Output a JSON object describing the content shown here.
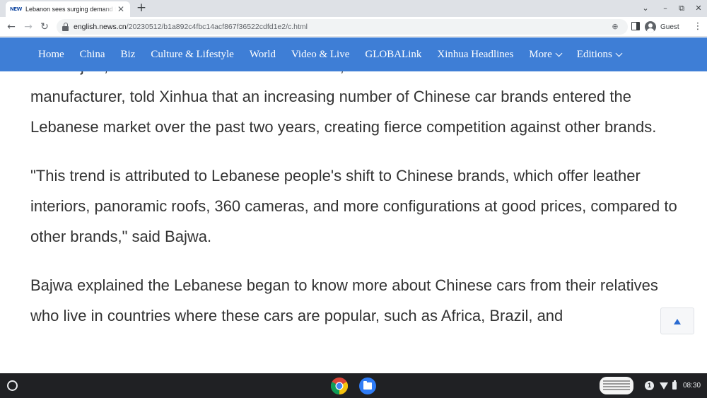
{
  "browser": {
    "tab": {
      "favicon_text": "NEW",
      "title": "Lebanon sees surging demand f",
      "close_glyph": "✕"
    },
    "new_tab_glyph": "+",
    "window_controls": {
      "dropdown": "⌄",
      "minimize": "–",
      "restore": "⧉",
      "close": "✕"
    },
    "nav": {
      "back": "←",
      "forward": "→",
      "reload": "↻"
    },
    "url": {
      "host": "english.news.cn",
      "path": "/20230512/b1a892c4fbc14acf867f36522cdfd1e2/c.html"
    },
    "zoom_glyph": "⊕",
    "profile_label": "Guest",
    "menu_glyph": "⋮"
  },
  "site_nav": {
    "items": [
      {
        "label": "Home"
      },
      {
        "label": "China"
      },
      {
        "label": "Biz"
      },
      {
        "label": "Culture & Lifestyle"
      },
      {
        "label": "World"
      },
      {
        "label": "Video & Live"
      },
      {
        "label": "GLOBALink"
      },
      {
        "label": "Xinhua Headlines"
      },
      {
        "label": "More",
        "dropdown": true
      },
      {
        "label": "Editions",
        "dropdown": true
      }
    ]
  },
  "article": {
    "paragraphs": [
      "Suk Bajwa, a sales consultant at JAC Motors, a Chinese automobile and commercial vehicle manufacturer, told Xinhua that an increasing number of Chinese car brands entered the Lebanese market over the past two years, creating fierce competition against other brands.",
      "\"This trend is attributed to Lebanese people's shift to Chinese brands, which offer leather interiors, panoramic roofs, 360 cameras, and more configurations at good prices, compared to other brands,\" said Bajwa.",
      "Bajwa explained the Lebanese began to know more about Chinese cars from their relatives who live in countries where these cars are popular, such as Africa, Brazil, and"
    ]
  },
  "shelf": {
    "notification_count": "1",
    "time": "08:30"
  }
}
